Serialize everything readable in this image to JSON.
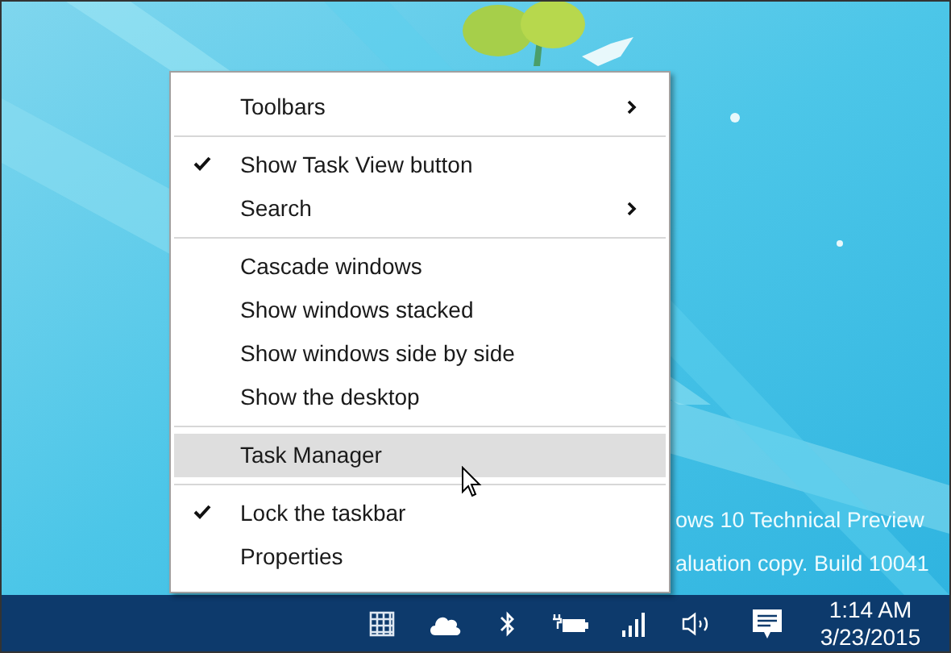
{
  "desktop": {
    "kind": "picture",
    "watermark": [
      "ows 10 Technical Preview",
      "aluation copy. Build 10041"
    ]
  },
  "context_menu": {
    "groups": [
      [
        {
          "label": "Toolbars",
          "checked": false,
          "has_submenu": true,
          "selected": false
        }
      ],
      [
        {
          "label": "Show Task View button",
          "checked": true,
          "has_submenu": false,
          "selected": false
        },
        {
          "label": "Search",
          "checked": false,
          "has_submenu": true,
          "selected": false
        }
      ],
      [
        {
          "label": "Cascade windows",
          "checked": false,
          "has_submenu": false,
          "selected": false
        },
        {
          "label": "Show windows stacked",
          "checked": false,
          "has_submenu": false,
          "selected": false
        },
        {
          "label": "Show windows side by side",
          "checked": false,
          "has_submenu": false,
          "selected": false
        },
        {
          "label": "Show the desktop",
          "checked": false,
          "has_submenu": false,
          "selected": false
        }
      ],
      [
        {
          "label": "Task Manager",
          "checked": false,
          "has_submenu": false,
          "selected": true
        }
      ],
      [
        {
          "label": "Lock the taskbar",
          "checked": true,
          "has_submenu": false,
          "selected": false
        },
        {
          "label": "Properties",
          "checked": false,
          "has_submenu": false,
          "selected": false
        }
      ]
    ]
  },
  "taskbar": {
    "tray_icons": [
      {
        "kind": "grid"
      },
      {
        "kind": "cloud"
      },
      {
        "kind": "bluetooth"
      },
      {
        "kind": "battery"
      },
      {
        "kind": "signal"
      },
      {
        "kind": "volume"
      },
      {
        "kind": "message"
      }
    ],
    "clock": {
      "time": "1:14 AM",
      "date": "3/23/2015"
    }
  }
}
